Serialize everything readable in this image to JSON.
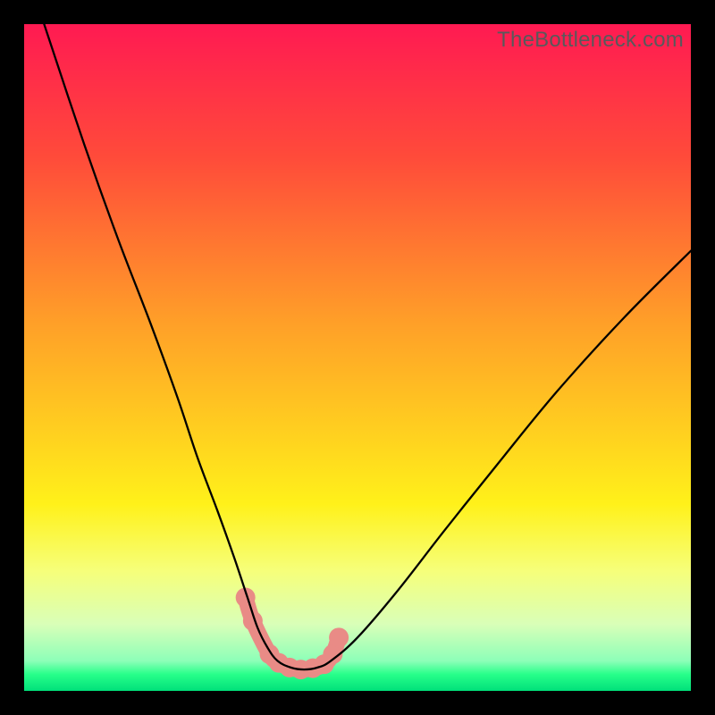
{
  "watermark": "TheBottleneck.com",
  "chart_data": {
    "type": "line",
    "title": "",
    "xlabel": "",
    "ylabel": "",
    "xlim": [
      0,
      100
    ],
    "ylim": [
      0,
      100
    ],
    "grid": false,
    "legend": false,
    "background": {
      "type": "vertical-gradient",
      "stops": [
        {
          "pos": 0.0,
          "color": "#ff1a52"
        },
        {
          "pos": 0.2,
          "color": "#ff4b3a"
        },
        {
          "pos": 0.45,
          "color": "#ffa028"
        },
        {
          "pos": 0.62,
          "color": "#ffd21f"
        },
        {
          "pos": 0.72,
          "color": "#fff11a"
        },
        {
          "pos": 0.82,
          "color": "#f6ff7a"
        },
        {
          "pos": 0.9,
          "color": "#d9ffb8"
        },
        {
          "pos": 0.955,
          "color": "#8dffb8"
        },
        {
          "pos": 0.975,
          "color": "#28ff8a"
        },
        {
          "pos": 1.0,
          "color": "#00e07a"
        }
      ]
    },
    "series": [
      {
        "name": "bottleneck-curve",
        "stroke": "#000000",
        "stroke_width": 2.3,
        "x": [
          3,
          9,
          14,
          19,
          23,
          26,
          29,
          31.5,
          33.5,
          35,
          36.5,
          38,
          40,
          42,
          44,
          46,
          50,
          56,
          63,
          71,
          80,
          90,
          100
        ],
        "values": [
          100,
          82,
          68,
          55,
          44,
          35,
          27,
          20,
          14,
          9.5,
          6.5,
          4.5,
          3.5,
          3.2,
          3.5,
          4.5,
          8,
          15,
          24,
          34,
          45,
          56,
          66
        ]
      },
      {
        "name": "highlight-nodes",
        "type": "scatter",
        "marker": "rounded-node",
        "color": "#e98b86",
        "x": [
          33.2,
          34.3,
          36.8,
          38.2,
          39.8,
          41.5,
          43.3,
          45.0,
          46.3,
          47.2
        ],
        "values": [
          14.0,
          10.5,
          5.5,
          4.2,
          3.5,
          3.2,
          3.4,
          4.0,
          5.5,
          8.0
        ]
      }
    ]
  }
}
